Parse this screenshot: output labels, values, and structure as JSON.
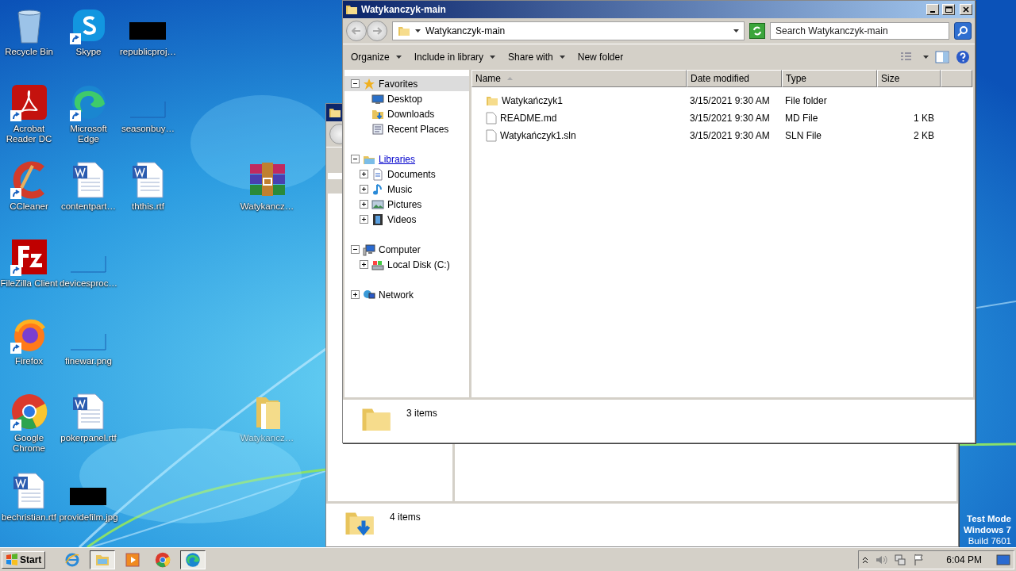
{
  "desktop": {
    "icons": [
      {
        "label": "Recycle Bin",
        "kind": "recycle",
        "shortcut": false
      },
      {
        "label": "Skype",
        "kind": "skype",
        "shortcut": true
      },
      {
        "label": "republicproj…",
        "kind": "thumb-black",
        "shortcut": false
      },
      {
        "label": "Acrobat Reader DC",
        "kind": "acrobat",
        "shortcut": true
      },
      {
        "label": "Microsoft Edge",
        "kind": "edge",
        "shortcut": true
      },
      {
        "label": "seasonbuy…",
        "kind": "thumb-blank",
        "shortcut": false
      },
      {
        "label": "CCleaner",
        "kind": "ccleaner",
        "shortcut": true
      },
      {
        "label": "contentpart…",
        "kind": "word",
        "shortcut": false
      },
      {
        "label": "ththis.rtf",
        "kind": "word",
        "shortcut": false
      },
      {
        "label": "Watykancz…",
        "kind": "archive",
        "shortcut": false
      },
      {
        "label": "FileZilla Client",
        "kind": "filezilla",
        "shortcut": true
      },
      {
        "label": "devicesproc…",
        "kind": "thumb-blank",
        "shortcut": false
      },
      {
        "label": "Firefox",
        "kind": "firefox",
        "shortcut": true
      },
      {
        "label": "finewar.png",
        "kind": "thumb-blank",
        "shortcut": false
      },
      {
        "label": "Google Chrome",
        "kind": "chrome",
        "shortcut": true
      },
      {
        "label": "pokerpanel.rtf",
        "kind": "word",
        "shortcut": false
      },
      {
        "label": "Watykancz…",
        "kind": "folder",
        "shortcut": false
      },
      {
        "label": "bechristian.rtf",
        "kind": "word",
        "shortcut": false
      },
      {
        "label": "providefilm.jpg",
        "kind": "thumb-black",
        "shortcut": false
      }
    ],
    "test_mode": [
      {
        "text": "Test Mode",
        "bold": true
      },
      {
        "text": "Windows 7",
        "bold": true
      },
      {
        "text": "Build 7601",
        "bold": false
      }
    ]
  },
  "back_window": {
    "status": "4 items"
  },
  "window": {
    "title": "Watykanczyk-main",
    "address": "Watykanczyk-main",
    "search": {
      "placeholder": "Search Watykanczyk-main"
    },
    "commands": [
      {
        "label": "Organize",
        "menu": true
      },
      {
        "label": "Include in library",
        "menu": true
      },
      {
        "label": "Share with",
        "menu": true
      },
      {
        "label": "New folder",
        "menu": false
      }
    ],
    "navigation": [
      {
        "label": "Favorites",
        "kind": "favorites",
        "expanded": true,
        "selected": true,
        "hot": false,
        "children": [
          {
            "label": "Desktop",
            "kind": "desktop",
            "selected": false,
            "hot": false
          },
          {
            "label": "Downloads",
            "kind": "downloads",
            "selected": false,
            "hot": false
          },
          {
            "label": "Recent Places",
            "kind": "recent",
            "selected": false,
            "hot": false
          }
        ]
      },
      {
        "label": "Libraries",
        "kind": "libraries",
        "expanded": true,
        "selected": false,
        "hot": true,
        "children": [
          {
            "label": "Documents",
            "kind": "documents",
            "expanded": false,
            "selected": false,
            "hot": false
          },
          {
            "label": "Music",
            "kind": "music",
            "expanded": false,
            "selected": false,
            "hot": false
          },
          {
            "label": "Pictures",
            "kind": "pictures",
            "expanded": false,
            "selected": false,
            "hot": false
          },
          {
            "label": "Videos",
            "kind": "videos",
            "expanded": false,
            "selected": false,
            "hot": false
          }
        ]
      },
      {
        "label": "Computer",
        "kind": "computer",
        "expanded": true,
        "selected": false,
        "hot": false,
        "children": [
          {
            "label": "Local Disk (C:)",
            "kind": "disk",
            "expanded": false,
            "selected": false,
            "hot": false
          }
        ]
      },
      {
        "label": "Network",
        "kind": "network",
        "expanded": false,
        "selected": false,
        "hot": false
      }
    ],
    "columns": [
      {
        "label": "Name",
        "sorted": true
      },
      {
        "label": "Date modified",
        "sorted": false
      },
      {
        "label": "Type",
        "sorted": false
      },
      {
        "label": "Size",
        "sorted": false
      }
    ],
    "rows": [
      {
        "kind": "folder",
        "name": "Watykańczyk1",
        "date": "3/15/2021 9:30 AM",
        "type": "File folder"
      },
      {
        "kind": "file",
        "name": "README.md",
        "date": "3/15/2021 9:30 AM",
        "type": "MD File",
        "size": "1 KB"
      },
      {
        "kind": "file",
        "name": "Watykańczyk1.sln",
        "date": "3/15/2021 9:30 AM",
        "type": "SLN File",
        "size": "2 KB"
      }
    ],
    "status": "3 items"
  },
  "taskbar": {
    "start": "Start",
    "buttons": [
      {
        "kind": "ie",
        "active": false
      },
      {
        "kind": "explorer",
        "active": true
      },
      {
        "kind": "media",
        "active": false
      },
      {
        "kind": "chrome",
        "active": false
      },
      {
        "kind": "edge",
        "active": true
      }
    ],
    "clock": "6:04 PM"
  }
}
